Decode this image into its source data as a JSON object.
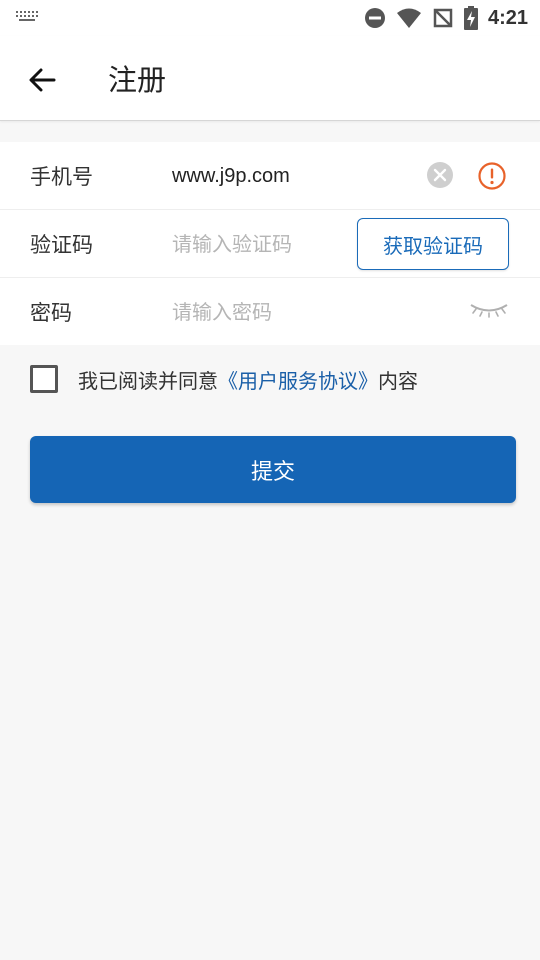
{
  "status_bar": {
    "time": "4:21",
    "icons": [
      "keyboard-icon",
      "dnd-icon",
      "wifi-icon",
      "no-signal-icon",
      "battery-charging-icon"
    ]
  },
  "header": {
    "title": "注册",
    "back_icon": "arrow-left-icon"
  },
  "form": {
    "phone": {
      "label": "手机号",
      "value": "www.j9p.com",
      "clear_icon": "clear-icon",
      "warning_icon": "warning-icon"
    },
    "code": {
      "label": "验证码",
      "placeholder": "请输入验证码",
      "button_label": "获取验证码"
    },
    "password": {
      "label": "密码",
      "placeholder": "请输入密码",
      "toggle_icon": "eye-closed-icon"
    }
  },
  "agreement": {
    "prefix": "我已阅读并同意",
    "link": "《用户服务协议》",
    "suffix": "内容",
    "checked": false
  },
  "submit": {
    "label": "提交"
  },
  "colors": {
    "primary": "#1565b5",
    "link": "#1a5fa8",
    "warning": "#e8622a",
    "background": "#f7f7f7"
  }
}
